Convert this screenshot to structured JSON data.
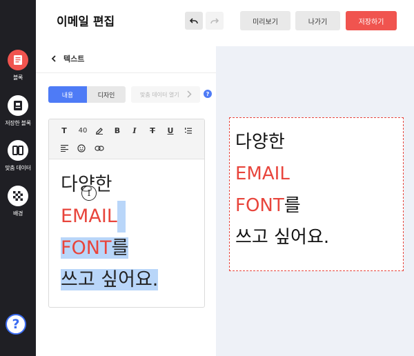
{
  "app": {
    "page_title": "이메일 편집"
  },
  "rail": {
    "items": [
      {
        "label": "블록",
        "icon": "document-icon"
      },
      {
        "label": "저장한 블록",
        "icon": "saved-block-icon"
      },
      {
        "label": "맞춤 데이터",
        "icon": "data-merge-icon"
      },
      {
        "label": "배경",
        "icon": "checkerboard-icon"
      }
    ],
    "help": "?"
  },
  "header": {
    "preview_label": "미리보기",
    "exit_label": "나가기",
    "save_label": "저장하기"
  },
  "panel": {
    "title": "텍스트",
    "tabs": [
      "내용",
      "디자인"
    ],
    "datamerge_label": "맞춤 데이터 열기",
    "help": "?",
    "toolbar": {
      "font_size": "40"
    }
  },
  "content": {
    "line1": "다양한",
    "line2": "EMAIL",
    "line3_accent": "FONT",
    "line3_rest": "를",
    "line4": "쓰고 싶어요."
  },
  "colors": {
    "accent": "#f0544f",
    "primary": "#4e7bf6",
    "text_red": "#e8453c",
    "selection": "#b9d6f9",
    "rail": "#1f1f24"
  }
}
